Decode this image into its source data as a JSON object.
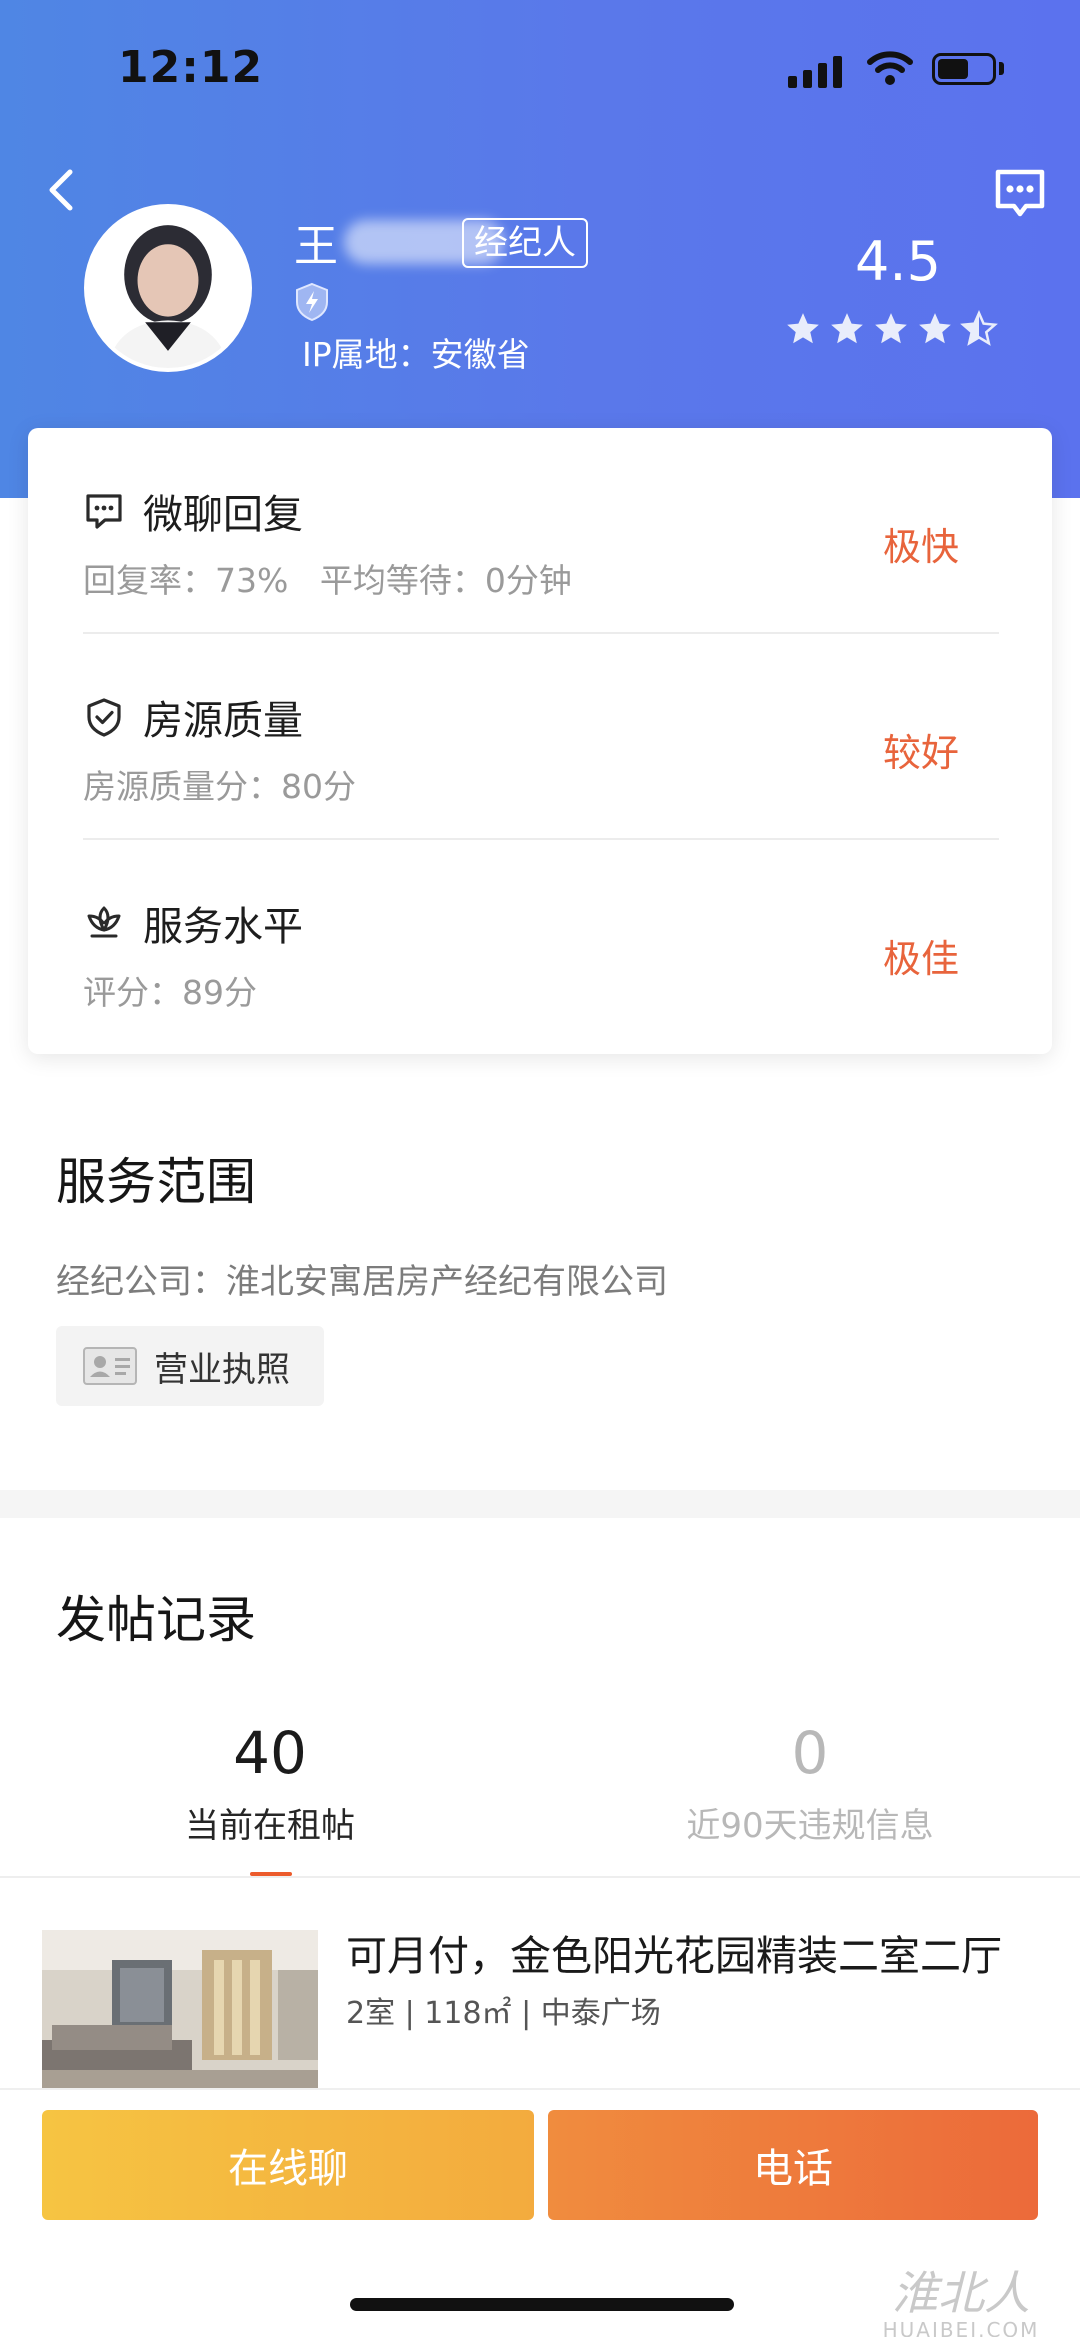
{
  "status_bar": {
    "time": "12:12"
  },
  "agent": {
    "name_visible": "王",
    "tag": "经纪人",
    "ip_location": "IP属地：安徽省",
    "rating": "4.5",
    "stars": 4.5
  },
  "scores": [
    {
      "icon": "chat-bubble-icon",
      "title": "微聊回复",
      "detail": "回复率：73%   平均等待：0分钟",
      "level": "极快"
    },
    {
      "icon": "shield-check-icon",
      "title": "房源质量",
      "detail": "房源质量分：80分",
      "level": "较好"
    },
    {
      "icon": "lotus-icon",
      "title": "服务水平",
      "detail": "评分：89分",
      "level": "极佳"
    }
  ],
  "service_scope": {
    "title": "服务范围",
    "company": "经纪公司：淮北安寓居房产经纪有限公司",
    "license_button": "营业执照"
  },
  "posts": {
    "title": "发帖记录",
    "tabs": [
      {
        "count": "40",
        "label": "当前在租帖",
        "active": true
      },
      {
        "count": "0",
        "label": "近90天违规信息",
        "active": false
      }
    ],
    "listing": {
      "title": "可月付，金色阳光花园精装二室二厅",
      "meta": "2室 | 118㎡ | 中泰广场"
    }
  },
  "actions": {
    "chat": "在线聊",
    "call": "电话"
  },
  "watermark": {
    "cn": "淮北人",
    "en": "HUAIBEI.COM"
  },
  "colors": {
    "accent": "#e8643c",
    "header_start": "#4f86e4",
    "header_end": "#5b72ee",
    "chat_btn": "#f6c442",
    "call_btn": "#ec6a3a"
  }
}
